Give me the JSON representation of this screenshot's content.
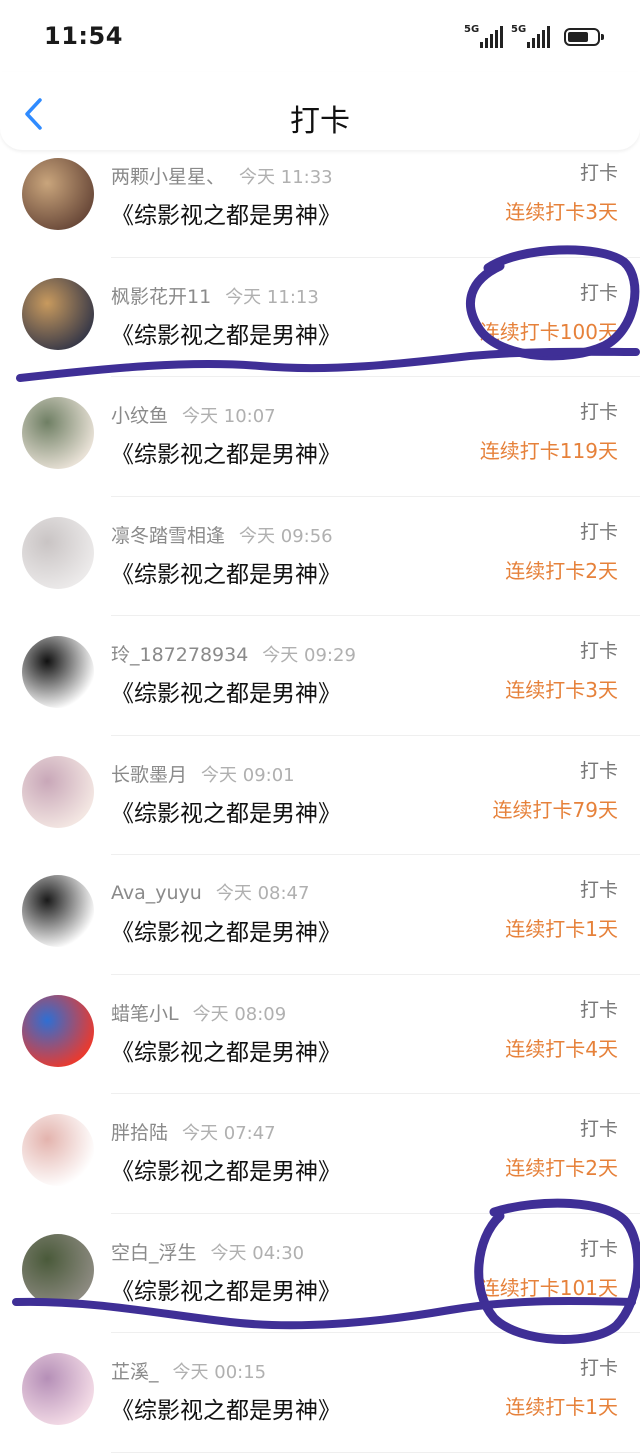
{
  "status_bar": {
    "time": "11:54",
    "network_1": "5G",
    "network_2": "5G"
  },
  "header": {
    "title": "打卡"
  },
  "rows": [
    {
      "name": "两颗小星星、",
      "time": "今天 11:33",
      "book": "《综影视之都是男神》",
      "action": "打卡",
      "streak": "连续打卡3天",
      "avatar_colors": [
        "#6b4a3a",
        "#c9a57c"
      ]
    },
    {
      "name": "枫影花开11",
      "time": "今天 11:13",
      "book": "《综影视之都是男神》",
      "action": "打卡",
      "streak": "连续打卡100天",
      "avatar_colors": [
        "#3a3a48",
        "#c89a5e"
      ]
    },
    {
      "name": "小纹鱼",
      "time": "今天 10:07",
      "book": "《综影视之都是男神》",
      "action": "打卡",
      "streak": "连续打卡119天",
      "avatar_colors": [
        "#e8e1d6",
        "#6f7f64"
      ]
    },
    {
      "name": "凛冬踏雪相逢",
      "time": "今天 09:56",
      "book": "《综影视之都是男神》",
      "action": "打卡",
      "streak": "连续打卡2天",
      "avatar_colors": [
        "#eceaea",
        "#c9c4c4"
      ]
    },
    {
      "name": "玲_187278934",
      "time": "今天 09:29",
      "book": "《综影视之都是男神》",
      "action": "打卡",
      "streak": "连续打卡3天",
      "avatar_colors": [
        "#ffffff",
        "#111111"
      ]
    },
    {
      "name": "长歌墨月",
      "time": "今天 09:01",
      "book": "《综影视之都是男神》",
      "action": "打卡",
      "streak": "连续打卡79天",
      "avatar_colors": [
        "#f3e6e2",
        "#c8a7b8"
      ]
    },
    {
      "name": "Ava_yuyu",
      "time": "今天 08:47",
      "book": "《综影视之都是男神》",
      "action": "打卡",
      "streak": "连续打卡1天",
      "avatar_colors": [
        "#ffffff",
        "#1a1a1a"
      ]
    },
    {
      "name": "蜡笔小L",
      "time": "今天 08:09",
      "book": "《综影视之都是男神》",
      "action": "打卡",
      "streak": "连续打卡4天",
      "avatar_colors": [
        "#e93a2f",
        "#2f6fd3"
      ]
    },
    {
      "name": "胖拾陆",
      "time": "今天 07:47",
      "book": "《综影视之都是男神》",
      "action": "打卡",
      "streak": "连续打卡2天",
      "avatar_colors": [
        "#ffffff",
        "#e3b3ad"
      ]
    },
    {
      "name": "空白_浮生",
      "time": "今天 04:30",
      "book": "《综影视之都是男神》",
      "action": "打卡",
      "streak": "连续打卡101天",
      "avatar_colors": [
        "#8c8a80",
        "#4a5a3a"
      ]
    },
    {
      "name": "芷溪_",
      "time": "今天 00:15",
      "book": "《综影视之都是男神》",
      "action": "打卡",
      "streak": "连续打卡1天",
      "avatar_colors": [
        "#f3dbe6",
        "#b58fb7"
      ]
    }
  ],
  "colors": {
    "accent": "#e6813a",
    "annotation": "#3f2f96"
  }
}
